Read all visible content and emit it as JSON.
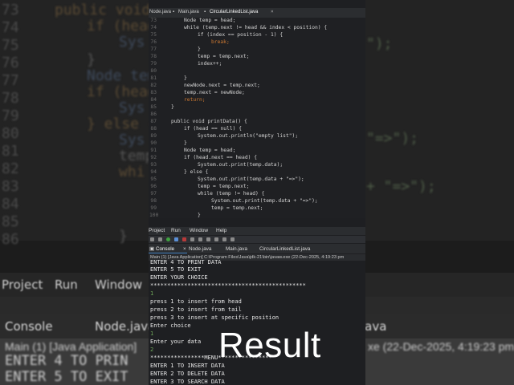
{
  "background": {
    "code_lines": [
      {
        "n": "73",
        "text": "public void"
      },
      {
        "n": "74",
        "text": "if (head"
      },
      {
        "n": "75",
        "text": "Sys"
      },
      {
        "n": "76",
        "text": ""
      },
      {
        "n": "77",
        "text": "}"
      },
      {
        "n": "78",
        "text": "Node temp"
      },
      {
        "n": "79",
        "text": "if (head"
      },
      {
        "n": "80",
        "text": "Sys"
      },
      {
        "n": "81",
        "text": "} else {"
      },
      {
        "n": "82",
        "text": "Sys"
      },
      {
        "n": "83",
        "text": "temp"
      },
      {
        "n": "84",
        "text": "whi"
      },
      {
        "n": "85",
        "text": ""
      },
      {
        "n": "86",
        "text": "}"
      }
    ],
    "right_fragments": [
      "\");",
      "\"=>\");",
      "+ \"=>\");"
    ],
    "menu": [
      "Project",
      "Run",
      "Window"
    ],
    "tabs": [
      "Console",
      "Node.java",
      "java"
    ],
    "console_status": "Main (1) [Java Application]",
    "console_status_right": "xe (22-Dec-2025, 4:19:23 pm",
    "console_lines": [
      "ENTER 4 TO PRIN",
      "ENTER 5 TO EXIT"
    ]
  },
  "editor": {
    "tabs": [
      "Node.java",
      "Main.java",
      "CircularLinkedList.java"
    ],
    "active_tab": 2,
    "line_numbers": [
      "",
      "",
      "",
      "",
      "",
      "",
      "",
      "",
      "",
      "",
      "",
      "",
      "",
      "",
      "",
      "",
      "",
      "",
      "",
      "",
      "",
      "",
      "",
      "",
      "",
      "",
      "",
      "",
      "",
      "",
      "",
      ""
    ],
    "code": [
      {
        "n": "73",
        "t": "Node temp = head;"
      },
      {
        "n": "74",
        "t": "while (temp.next != head && index < position) {"
      },
      {
        "n": "75",
        "t": "if (index == position - 1) {"
      },
      {
        "n": "76",
        "t": "break;"
      },
      {
        "n": "77",
        "t": "}"
      },
      {
        "n": "78",
        "t": "temp = temp.next;"
      },
      {
        "n": "79",
        "t": "index++;"
      },
      {
        "n": "80",
        "t": ""
      },
      {
        "n": "81",
        "t": "}"
      },
      {
        "n": "82",
        "t": "newNode.next = temp.next;"
      },
      {
        "n": "83",
        "t": "temp.next = newNode;"
      },
      {
        "n": "84",
        "t": "return;"
      },
      {
        "n": "85",
        "t": "}"
      },
      {
        "n": "86",
        "t": ""
      },
      {
        "n": "87",
        "t": "public void printData() {"
      },
      {
        "n": "88",
        "t": "if (head == null) {"
      },
      {
        "n": "89",
        "t": "System.out.println(\"empty list\");"
      },
      {
        "n": "90",
        "t": "}"
      },
      {
        "n": "91",
        "t": "Node temp = head;"
      },
      {
        "n": "92",
        "t": "if (head.next == head) {"
      },
      {
        "n": "93",
        "t": "System.out.print(temp.data);"
      },
      {
        "n": "94",
        "t": "} else {"
      },
      {
        "n": "95",
        "t": "System.out.print(temp.data + \"=>\");"
      },
      {
        "n": "96",
        "t": "temp = temp.next;"
      },
      {
        "n": "97",
        "t": "while (temp != head) {"
      },
      {
        "n": "98",
        "t": "System.out.print(temp.data + \"=>\");"
      },
      {
        "n": "99",
        "t": "temp = temp.next;"
      },
      {
        "n": "100",
        "t": ""
      },
      {
        "n": "101",
        "t": "}"
      }
    ],
    "visible_line_numbers": [
      "73",
      "74",
      "75",
      "76",
      "77",
      "78",
      "79",
      "80",
      "81",
      "82",
      "83",
      "84",
      "85",
      "86",
      "87",
      "88",
      "89",
      "90",
      "91",
      "92",
      "93",
      "94",
      "95",
      "96",
      "97",
      "98",
      "99",
      "00",
      "01",
      "02",
      "03",
      "04",
      "05",
      "06",
      "07",
      "08"
    ]
  },
  "menubar": [
    "Project",
    "Run",
    "Window",
    "Help"
  ],
  "console_tabs": [
    "Console",
    "Node.java",
    "Main.java",
    "CircularLinkedList.java"
  ],
  "console_status": "Main (1) [Java Application] C:\\Program Files\\Java\\jdk-21\\bin\\javaw.exe  (22-Dec-2025, 4:19:23 pm",
  "console_lines": [
    {
      "t": "ENTER 4 TO PRINT DATA",
      "input": false
    },
    {
      "t": "ENTER 5 TO EXIT",
      "input": false
    },
    {
      "t": "ENTER YOUR CHOICE",
      "input": false
    },
    {
      "t": "**********************************************",
      "input": false
    },
    {
      "t": "1",
      "input": true
    },
    {
      "t": "press 1 to insert from head",
      "input": false
    },
    {
      "t": "press 2 to insert from tail",
      "input": false
    },
    {
      "t": "press 3 to insert at specific position",
      "input": false
    },
    {
      "t": "Enter choice",
      "input": false
    },
    {
      "t": "1",
      "input": true
    },
    {
      "t": "Enter your data",
      "input": false
    },
    {
      "t": "2",
      "input": true
    },
    {
      "t": "****************MENU****************",
      "input": false
    },
    {
      "t": "ENTER 1 TO INSERT DATA",
      "input": false
    },
    {
      "t": "ENTER 2 TO DELETE DATA",
      "input": false
    },
    {
      "t": "ENTER 3 TO SEARCH DATA",
      "input": false
    }
  ],
  "overlay_text": "Result",
  "colors": {
    "editor_bg": "#1f2023",
    "keyword": "#cc7832",
    "field": "#9876aa",
    "string": "#6a8759",
    "input_text": "#6ea65a",
    "accent": "#4a88c7"
  }
}
